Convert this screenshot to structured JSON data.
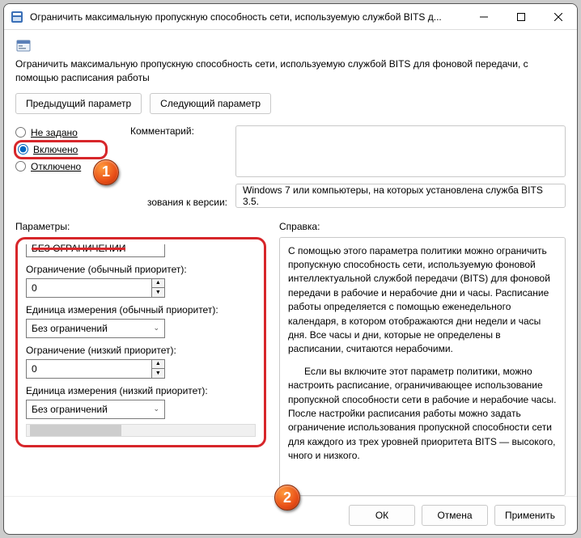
{
  "titlebar": {
    "title": "Ограничить максимальную пропускную способность сети, используемую службой BITS д..."
  },
  "header": {
    "description": "Ограничить максимальную пропускную способность сети, используемую службой BITS для фоновой передачи, с помощью расписания работы"
  },
  "nav": {
    "prev": "Предыдущий параметр",
    "next": "Следующий параметр"
  },
  "state": {
    "not_configured": "Не задано",
    "enabled": "Включено",
    "disabled": "Отключено",
    "selected": "enabled"
  },
  "comment": {
    "label": "Комментарий:",
    "value": ""
  },
  "version": {
    "label": "зования к версии:",
    "value": "Windows 7 или компьютеры, на которых установлена служба BITS 3.5."
  },
  "params": {
    "label": "Параметры:",
    "top_select": "БЕЗ ОГРАНИЧЕНИЙ",
    "limit_normal_label": "Ограничение (обычный приоритет):",
    "limit_normal_value": "0",
    "unit_normal_label": "Единица измерения (обычный приоритет):",
    "unit_normal_value": "Без ограничений",
    "limit_low_label": "Ограничение (низкий приоритет):",
    "limit_low_value": "0",
    "unit_low_label": "Единица измерения (низкий приоритет):",
    "unit_low_value": "Без ограничений"
  },
  "help": {
    "label": "Справка:",
    "p1": "С помощью этого параметра политики можно ограничить пропускную способность сети, используемую фоновой интеллектуальной службой передачи (BITS) для фоновой передачи в рабочие и нерабочие дни и часы. Расписание работы определяется с помощью еженедельного календаря, в котором отображаются дни недели и часы дня. Все часы и дни, которые не определены в расписании, считаются нерабочими.",
    "p2": "Если вы включите этот параметр политики, можно настроить расписание, ограничивающее использование пропускной способности сети в рабочие и нерабочие часы. После настройки расписания работы можно задать ограничение использования пропускной способности сети для каждого из трех уровней приоритета BITS — высокого, чного и низкого."
  },
  "footer": {
    "ok": "ОК",
    "cancel": "Отмена",
    "apply": "Применить"
  },
  "callouts": {
    "c1": "1",
    "c2": "2"
  }
}
